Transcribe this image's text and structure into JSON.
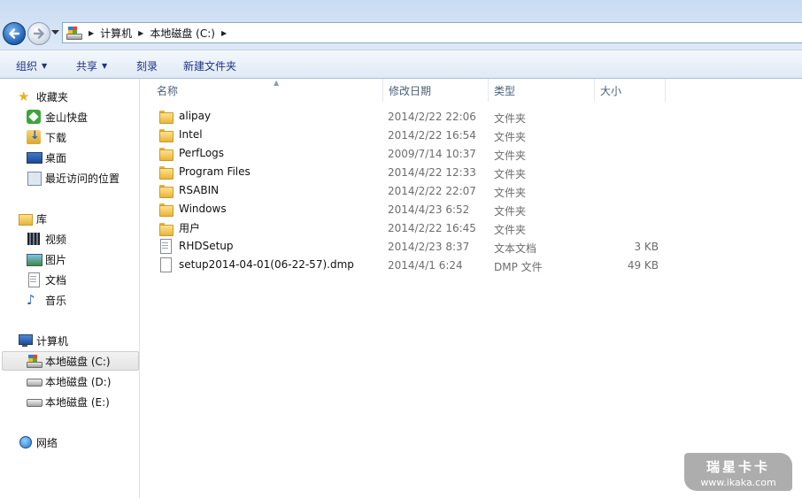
{
  "address_bar": {
    "crumbs": [
      "计算机",
      "本地磁盘 (C:)"
    ]
  },
  "toolbar": {
    "organize": "组织",
    "share": "共享",
    "burn": "刻录",
    "new_folder": "新建文件夹"
  },
  "nav": {
    "favorites": {
      "label": "收藏夹",
      "items": [
        "金山快盘",
        "下载",
        "桌面",
        "最近访问的位置"
      ]
    },
    "libraries": {
      "label": "库",
      "items": [
        "视频",
        "图片",
        "文档",
        "音乐"
      ]
    },
    "computer": {
      "label": "计算机",
      "items": [
        "本地磁盘 (C:)",
        "本地磁盘 (D:)",
        "本地磁盘 (E:)"
      ]
    },
    "network": {
      "label": "网络"
    }
  },
  "columns": {
    "name": "名称",
    "date": "修改日期",
    "type": "类型",
    "size": "大小"
  },
  "files": [
    {
      "name": "alipay",
      "date": "2014/2/22 22:06",
      "type": "文件夹",
      "size": "",
      "icon": "folder-icon"
    },
    {
      "name": "Intel",
      "date": "2014/2/22 16:54",
      "type": "文件夹",
      "size": "",
      "icon": "folder-icon"
    },
    {
      "name": "PerfLogs",
      "date": "2009/7/14 10:37",
      "type": "文件夹",
      "size": "",
      "icon": "folder-icon"
    },
    {
      "name": "Program Files",
      "date": "2014/4/22 12:33",
      "type": "文件夹",
      "size": "",
      "icon": "folder-icon"
    },
    {
      "name": "RSABIN",
      "date": "2014/2/22 22:07",
      "type": "文件夹",
      "size": "",
      "icon": "folder-icon"
    },
    {
      "name": "Windows",
      "date": "2014/4/23 6:52",
      "type": "文件夹",
      "size": "",
      "icon": "folder-icon"
    },
    {
      "name": "用户",
      "date": "2014/2/22 16:45",
      "type": "文件夹",
      "size": "",
      "icon": "folder-icon"
    },
    {
      "name": "RHDSetup",
      "date": "2014/2/23 8:37",
      "type": "文本文档",
      "size": "3 KB",
      "icon": "text-document-icon"
    },
    {
      "name": "setup2014-04-01(06-22-57).dmp",
      "date": "2014/4/1 6:24",
      "type": "DMP 文件",
      "size": "49 KB",
      "icon": "file-icon"
    }
  ],
  "watermark": {
    "title": "瑞星卡卡",
    "url": "www.ikaka.com"
  },
  "colors": {
    "toolbar_text": "#1e3287",
    "column_header": "#4c607a",
    "detail_text": "#6d6d6d"
  }
}
